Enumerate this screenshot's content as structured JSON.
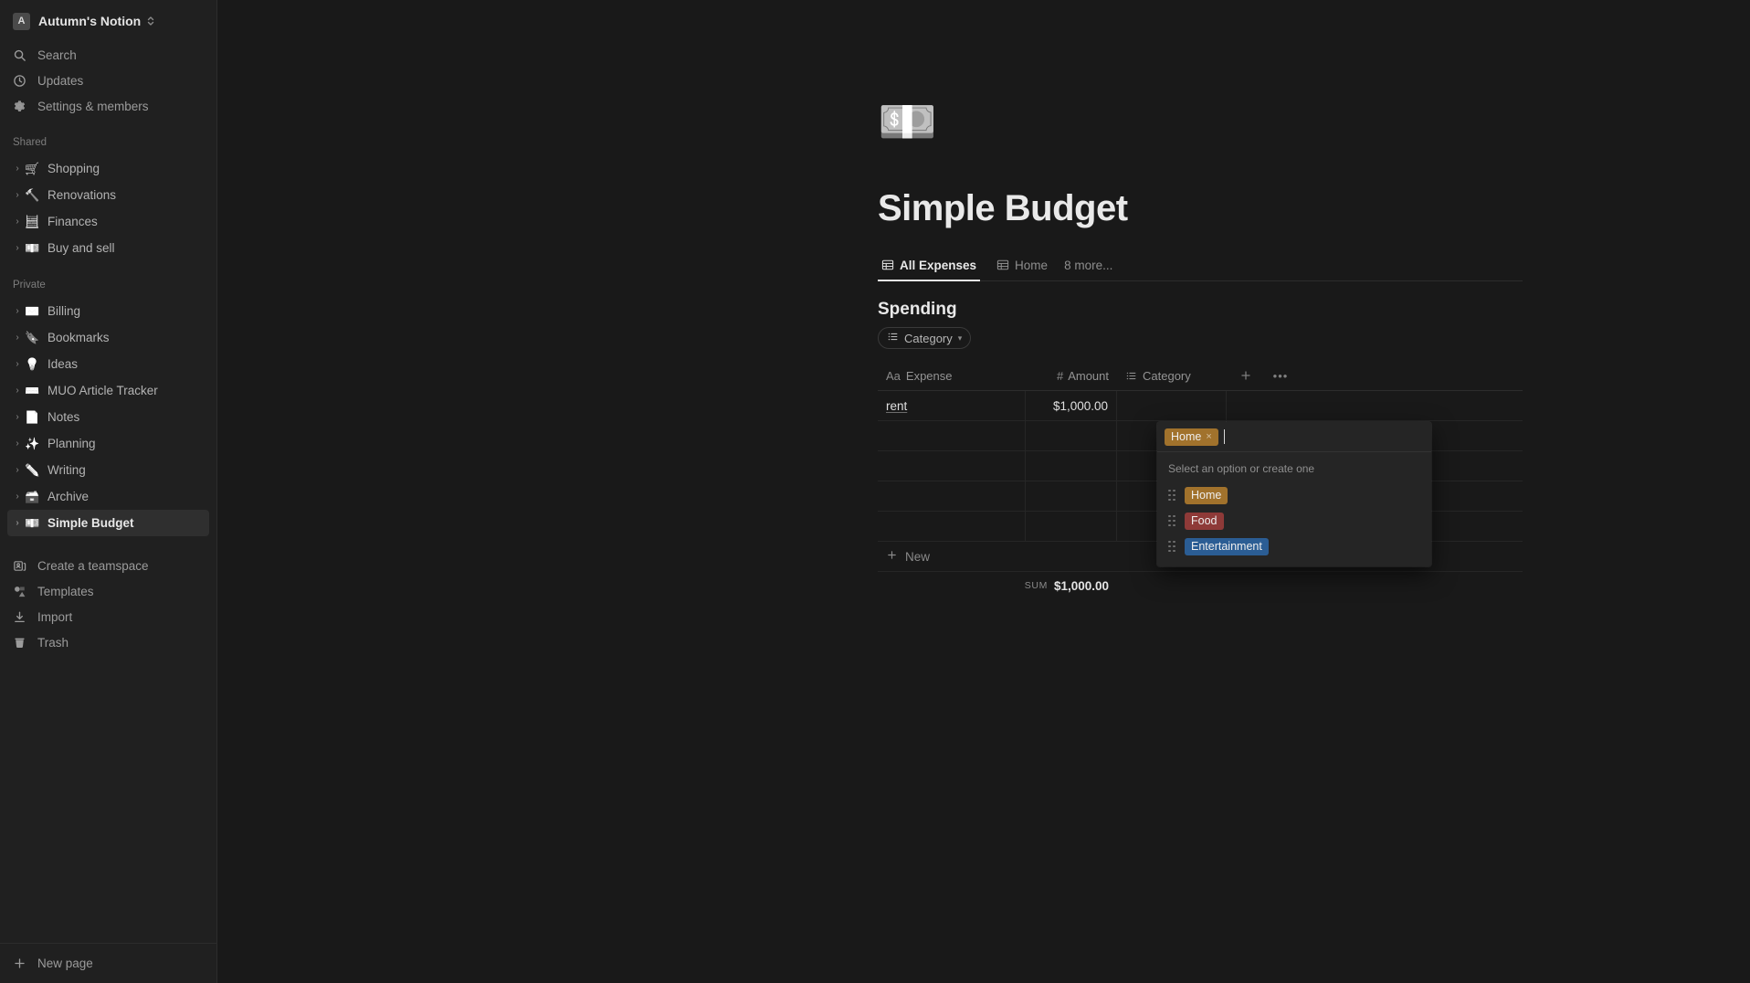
{
  "workspace": {
    "avatar_letter": "A",
    "name": "Autumn's Notion",
    "switcher_icon": "chevron-up-down-icon"
  },
  "sidebar": {
    "nav": [
      {
        "label": "Search",
        "icon": "search-icon"
      },
      {
        "label": "Updates",
        "icon": "clock-icon"
      },
      {
        "label": "Settings & members",
        "icon": "gear-icon"
      }
    ],
    "shared_label": "Shared",
    "shared": [
      {
        "label": "Shopping",
        "icon": "shopping-cart-emoji",
        "emoji": "🛒"
      },
      {
        "label": "Renovations",
        "icon": "hammer-emoji",
        "emoji": "🔨"
      },
      {
        "label": "Finances",
        "icon": "abacus-emoji",
        "emoji": "🧮"
      },
      {
        "label": "Buy and sell",
        "icon": "banknote-emoji",
        "emoji": "💵"
      }
    ],
    "private_label": "Private",
    "private": [
      {
        "label": "Billing",
        "icon": "envelope-emoji",
        "emoji": "✉️"
      },
      {
        "label": "Bookmarks",
        "icon": "bookmark-emoji",
        "emoji": "🔖"
      },
      {
        "label": "Ideas",
        "icon": "lightbulb-emoji",
        "emoji": "💡"
      },
      {
        "label": "MUO Article Tracker",
        "icon": "keyboard-emoji",
        "emoji": "⌨️"
      },
      {
        "label": "Notes",
        "icon": "page-emoji",
        "emoji": "📄"
      },
      {
        "label": "Planning",
        "icon": "sparkles-emoji",
        "emoji": "✨"
      },
      {
        "label": "Writing",
        "icon": "pencil-emoji",
        "emoji": "✏️"
      },
      {
        "label": "Archive",
        "icon": "file-box-emoji",
        "emoji": "🗃️"
      },
      {
        "label": "Simple Budget",
        "icon": "banknote-emoji",
        "emoji": "💵",
        "active": true
      }
    ],
    "actions": [
      {
        "label": "Create a teamspace",
        "icon": "teamspace-icon"
      },
      {
        "label": "Templates",
        "icon": "templates-icon"
      },
      {
        "label": "Import",
        "icon": "import-icon"
      },
      {
        "label": "Trash",
        "icon": "trash-icon"
      }
    ],
    "footer": {
      "label": "New page",
      "icon": "plus-icon"
    }
  },
  "page": {
    "emoji": "💵",
    "emoji_name": "banknote-emoji",
    "title": "Simple Budget",
    "tabs": [
      {
        "label": "All Expenses",
        "icon": "table-icon",
        "active": true
      },
      {
        "label": "Home",
        "icon": "table-icon",
        "active": false
      }
    ],
    "tabs_more": "8 more..."
  },
  "database": {
    "title": "Spending",
    "filter": {
      "label": "Category",
      "icon": "list-icon",
      "chevron": "chevron-down-icon"
    },
    "columns": [
      {
        "label": "Expense",
        "type_icon": "Aa"
      },
      {
        "label": "Amount",
        "type_icon": "#"
      },
      {
        "label": "Category",
        "type_icon": "list-icon"
      }
    ],
    "add_column_label": "+",
    "more_options_label": "•••",
    "rows": [
      {
        "expense": "rent",
        "amount": "$1,000.00",
        "category": "Home"
      }
    ],
    "empty_row_count": 4,
    "new_row_label": "New",
    "sum_label": "SUM",
    "sum_value": "$1,000.00"
  },
  "cell_editor": {
    "selected_tag": "Home",
    "remove_label": "×",
    "hint": "Select an option or create one",
    "options": [
      {
        "label": "Home",
        "color": "#a1722c"
      },
      {
        "label": "Food",
        "color": "#8e3a38"
      },
      {
        "label": "Entertainment",
        "color": "#2b5d94"
      }
    ]
  },
  "colors": {
    "background": "#191919",
    "sidebar": "#202020",
    "tag_home": "#a1722c",
    "tag_food": "#8e3a38",
    "tag_entertainment": "#2b5d94"
  }
}
